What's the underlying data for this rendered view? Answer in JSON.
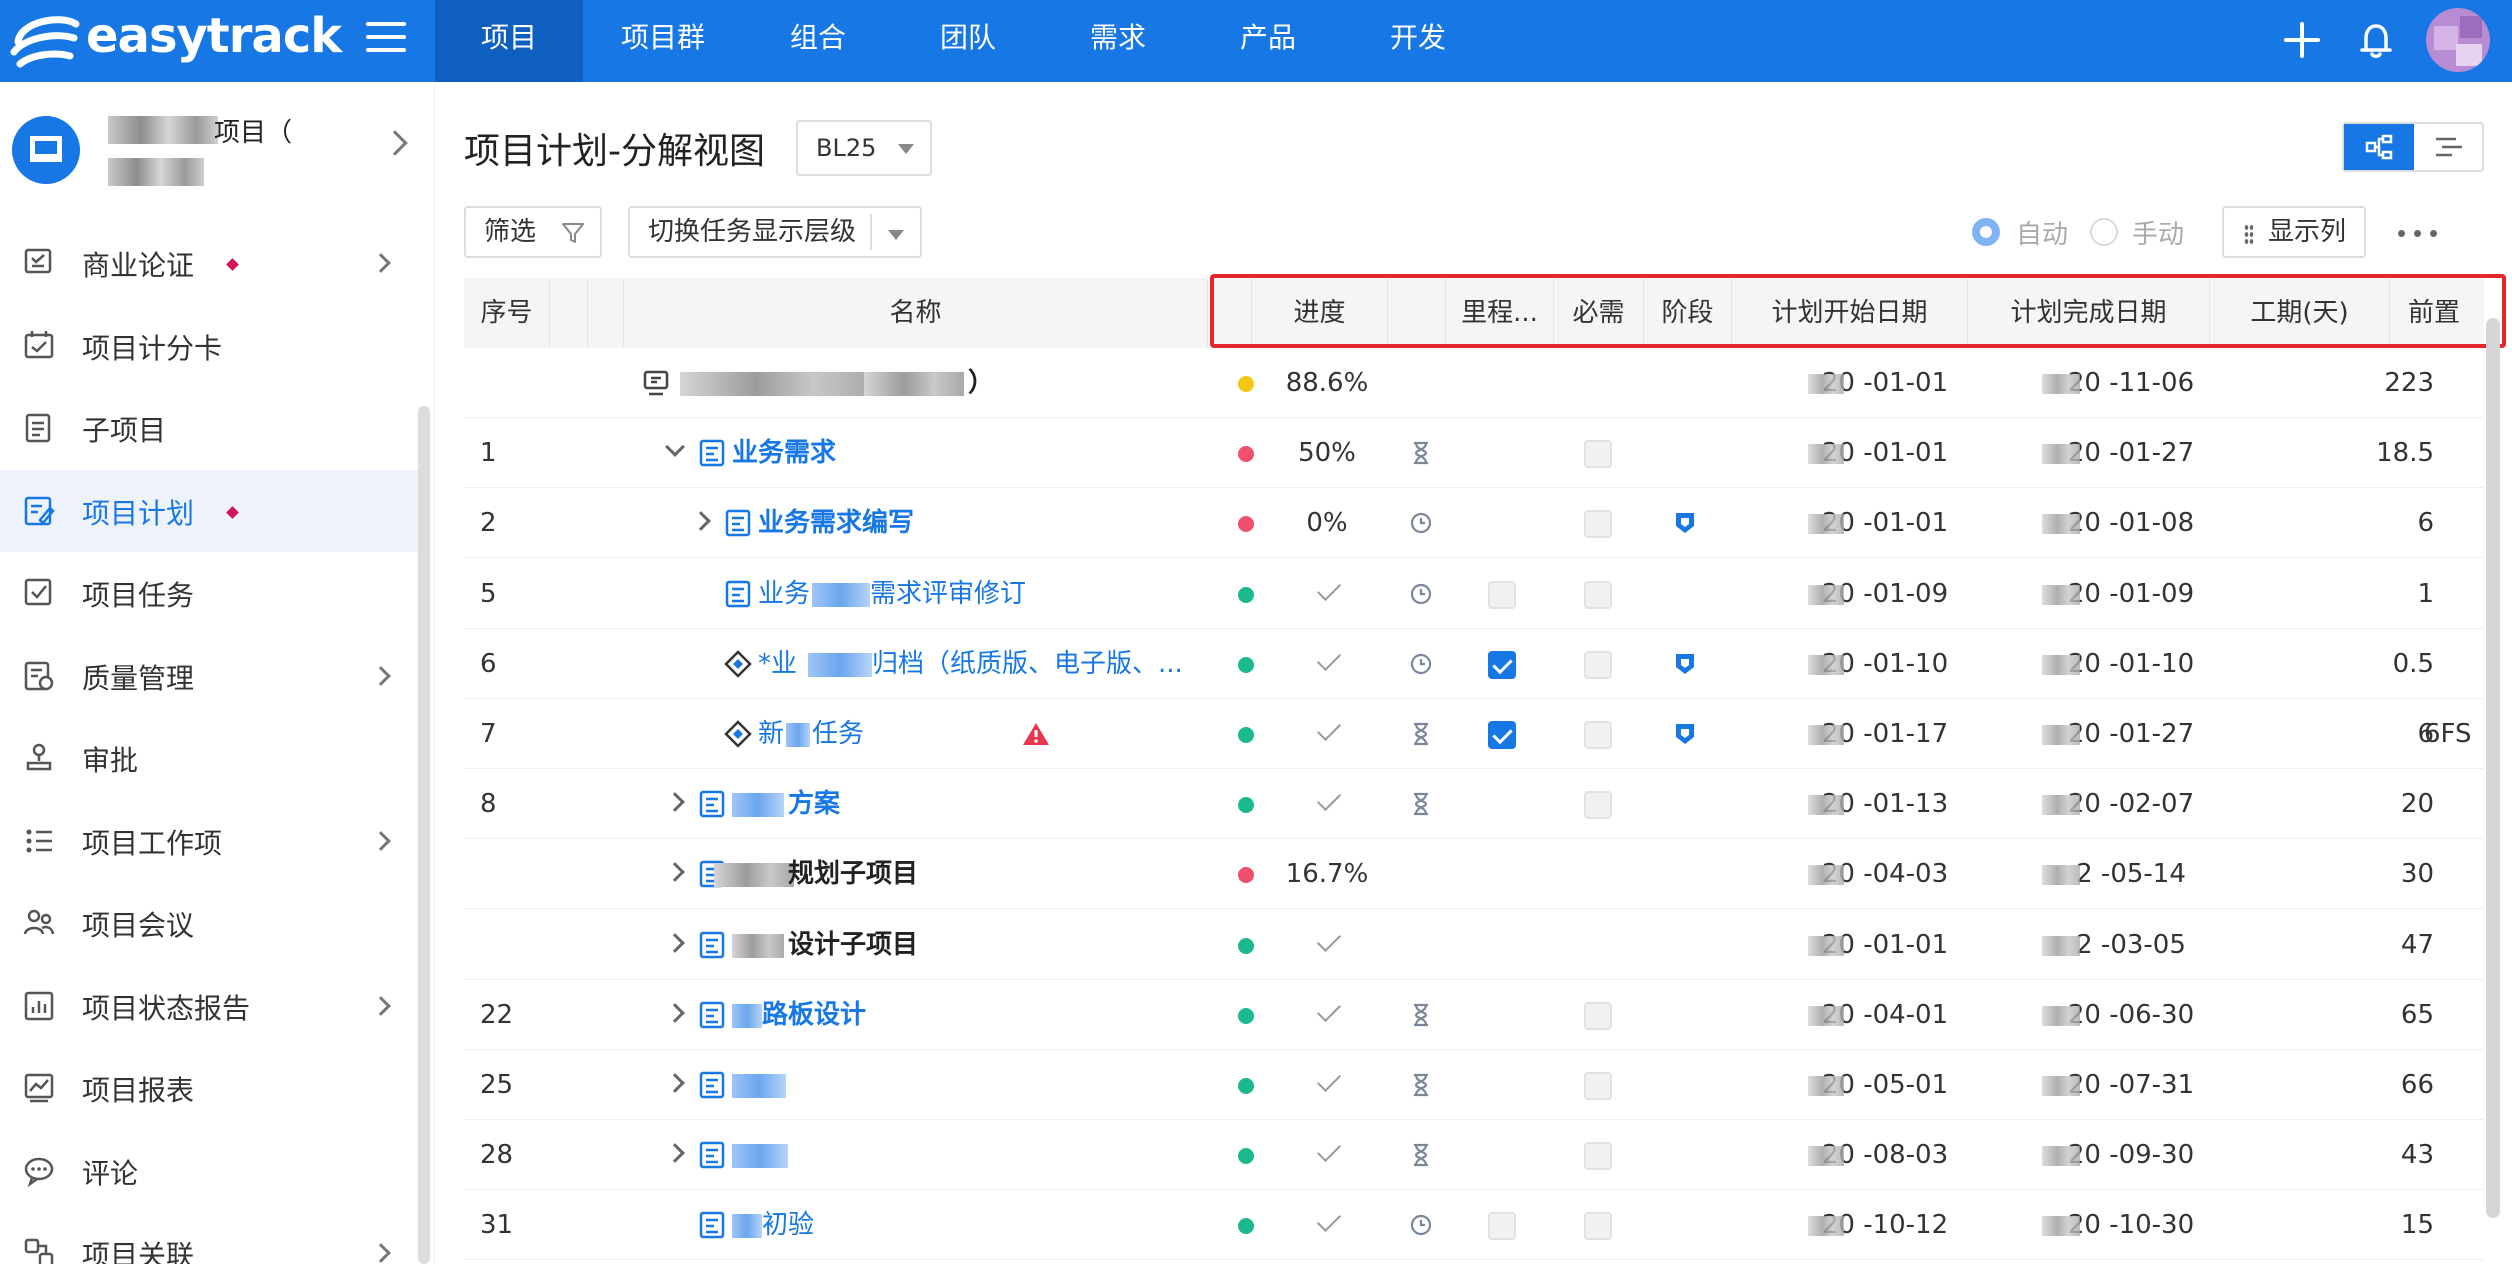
{
  "app": {
    "logo_text": "easytrack"
  },
  "nav": {
    "tabs": [
      "项目",
      "项目群",
      "组合",
      "团队",
      "需求",
      "产品",
      "开发"
    ],
    "active_index": 0
  },
  "sidebar": {
    "project_name": "项目（",
    "items": [
      {
        "label": "商业论证",
        "icon": "business-case-icon",
        "dot": true,
        "chevron": true
      },
      {
        "label": "项目计分卡",
        "icon": "scorecard-icon",
        "dot": false,
        "chevron": false
      },
      {
        "label": "子项目",
        "icon": "subproject-icon",
        "dot": false,
        "chevron": false
      },
      {
        "label": "项目计划",
        "icon": "plan-icon",
        "dot": true,
        "chevron": false,
        "active": true
      },
      {
        "label": "项目任务",
        "icon": "task-icon",
        "dot": false,
        "chevron": false
      },
      {
        "label": "质量管理",
        "icon": "quality-icon",
        "dot": false,
        "chevron": true
      },
      {
        "label": "审批",
        "icon": "approval-icon",
        "dot": false,
        "chevron": false
      },
      {
        "label": "项目工作项",
        "icon": "workitem-icon",
        "dot": false,
        "chevron": true
      },
      {
        "label": "项目会议",
        "icon": "meeting-icon",
        "dot": false,
        "chevron": false
      },
      {
        "label": "项目状态报告",
        "icon": "status-report-icon",
        "dot": false,
        "chevron": true
      },
      {
        "label": "项目报表",
        "icon": "report-icon",
        "dot": false,
        "chevron": false
      },
      {
        "label": "评论",
        "icon": "comment-icon",
        "dot": false,
        "chevron": false
      },
      {
        "label": "项目关联",
        "icon": "relation-icon",
        "dot": false,
        "chevron": true
      }
    ]
  },
  "main": {
    "title": "项目计划-分解视图",
    "baseline": "BL25",
    "filter_label": "筛选",
    "level_label": "切换任务显示层级",
    "mode_auto": "自动",
    "mode_manual": "手动",
    "columns_label": "显示列"
  },
  "table": {
    "headers": {
      "seq": "序号",
      "name": "名称",
      "progress": "进度",
      "milestone": "里程...",
      "required": "必需",
      "phase": "阶段",
      "start": "计划开始日期",
      "finish": "计划完成日期",
      "duration": "工期(天)",
      "predecessor": "前置任"
    },
    "status_colors": {
      "yellow": "#f5c518",
      "red": "#f0506e",
      "green": "#1bb98d"
    },
    "rows": [
      {
        "seq": "",
        "name": "）",
        "status": "yellow",
        "progress": "88.6%",
        "type": "",
        "milestone": null,
        "required": null,
        "phase": false,
        "start": "20  -01-01",
        "finish": "20  -11-06",
        "duration": "223",
        "pred": ""
      },
      {
        "seq": "1",
        "name": "业务需求",
        "status": "red",
        "progress": "50%",
        "type": "hourglass",
        "milestone": null,
        "required": false,
        "phase": false,
        "start": "20  -01-01",
        "finish": "20  -01-27",
        "duration": "18.5",
        "pred": ""
      },
      {
        "seq": "2",
        "name": "业务需求编写",
        "status": "red",
        "progress": "0%",
        "type": "clock",
        "milestone": null,
        "required": false,
        "phase": true,
        "start": "20  -01-01",
        "finish": "20  -01-08",
        "duration": "6",
        "pred": ""
      },
      {
        "seq": "5",
        "name": "需求评审修订",
        "name_prefix": "业务",
        "status": "green",
        "progress": "",
        "type": "clock",
        "milestone": false,
        "required": false,
        "phase": false,
        "start": "20  -01-09",
        "finish": "20  -01-09",
        "duration": "1",
        "pred": ""
      },
      {
        "seq": "6",
        "name": "归档（纸质版、电子版、...",
        "name_prefix": "*业",
        "status": "green",
        "progress": "",
        "type": "clock",
        "milestone": true,
        "required": false,
        "phase": true,
        "start": "20  -01-10",
        "finish": "20  -01-10",
        "duration": "0.5",
        "pred": ""
      },
      {
        "seq": "7",
        "name": "任务",
        "name_prefix": "新",
        "status": "green",
        "progress": "",
        "type": "hourglass",
        "milestone": true,
        "required": false,
        "phase": true,
        "start": "20  -01-17",
        "finish": "20  -01-27",
        "duration": "6",
        "pred": "6FS"
      },
      {
        "seq": "8",
        "name": "方案",
        "status": "green",
        "progress": "",
        "type": "hourglass",
        "milestone": null,
        "required": false,
        "phase": false,
        "start": "20  -01-13",
        "finish": "20  -02-07",
        "duration": "20",
        "pred": ""
      },
      {
        "seq": "",
        "name": "规划子项目",
        "status": "red",
        "progress": "16.7%",
        "type": "",
        "milestone": null,
        "required": null,
        "phase": false,
        "start": "20  -04-03",
        "finish": "2  -05-14",
        "duration": "30",
        "pred": ""
      },
      {
        "seq": "",
        "name": "设计子项目",
        "status": "green",
        "progress": "",
        "type": "",
        "milestone": null,
        "required": null,
        "phase": false,
        "start": "20  -01-01",
        "finish": "2  -03-05",
        "duration": "47",
        "pred": ""
      },
      {
        "seq": "22",
        "name": "路板设计",
        "status": "green",
        "progress": "",
        "type": "hourglass",
        "milestone": null,
        "required": false,
        "phase": false,
        "start": "20  -04-01",
        "finish": "20  -06-30",
        "duration": "65",
        "pred": ""
      },
      {
        "seq": "25",
        "name": "",
        "status": "green",
        "progress": "",
        "type": "hourglass",
        "milestone": null,
        "required": false,
        "phase": false,
        "start": "20  -05-01",
        "finish": "20  -07-31",
        "duration": "66",
        "pred": ""
      },
      {
        "seq": "28",
        "name": "",
        "status": "green",
        "progress": "",
        "type": "hourglass",
        "milestone": null,
        "required": false,
        "phase": false,
        "start": "20  -08-03",
        "finish": "20  -09-30",
        "duration": "43",
        "pred": ""
      },
      {
        "seq": "31",
        "name": "初验",
        "status": "green",
        "progress": "",
        "type": "clock",
        "milestone": false,
        "required": false,
        "phase": false,
        "start": "20  -10-12",
        "finish": "20  -10-30",
        "duration": "15",
        "pred": ""
      }
    ]
  }
}
